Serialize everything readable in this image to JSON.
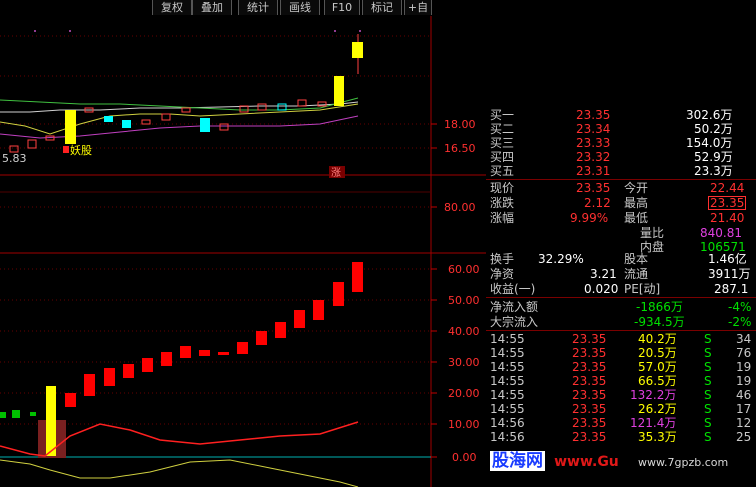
{
  "toolbar": {
    "buttons": [
      "复权",
      "叠加",
      "统计",
      "画线",
      "F10",
      "标记",
      "+自"
    ],
    "diamond": "◇"
  },
  "chart": {
    "price_axis": [
      "18.00",
      "16.50"
    ],
    "vol_axis": [
      "80.00"
    ],
    "ind_axis": [
      "60.00",
      "50.00",
      "40.00",
      "30.00",
      "20.00",
      "10.00",
      "0.00"
    ],
    "low_label": "5.83",
    "tag": "妖股",
    "zhang_badge": "涨"
  },
  "quotes": {
    "buy": [
      {
        "name": "买一",
        "price": "23.35",
        "vol": "302.6万"
      },
      {
        "name": "买二",
        "price": "23.34",
        "vol": "50.2万"
      },
      {
        "name": "买三",
        "price": "23.33",
        "vol": "154.0万"
      },
      {
        "name": "买四",
        "price": "23.32",
        "vol": "52.9万"
      },
      {
        "name": "买五",
        "price": "23.31",
        "vol": "23.3万"
      }
    ]
  },
  "stats": {
    "xianjia": {
      "label": "现价",
      "value": "23.35"
    },
    "jinkai": {
      "label": "今开",
      "value": "22.44"
    },
    "zhangdie": {
      "label": "涨跌",
      "value": "2.12"
    },
    "zuigao": {
      "label": "最高",
      "value": "23.35"
    },
    "zhangfu": {
      "label": "涨幅",
      "value": "9.99%"
    },
    "zuidi": {
      "label": "最低",
      "value": "21.40"
    },
    "liangbi": {
      "label": "量比",
      "value": "840.81"
    },
    "neipan": {
      "label": "内盘",
      "value": "106571"
    },
    "huanshou": {
      "label": "换手",
      "value": "32.29%"
    },
    "guben": {
      "label": "股本",
      "value": "1.46亿"
    },
    "jingzi": {
      "label": "净资",
      "value": "3.21"
    },
    "liutong": {
      "label": "流通",
      "value": "3911万"
    },
    "shouyi": {
      "label": "收益(一)",
      "value": "0.020"
    },
    "pe": {
      "label": "PE[动]",
      "value": "287.1"
    }
  },
  "flows": [
    {
      "label": "净流入额",
      "value": "-1866万",
      "pct": "-4%"
    },
    {
      "label": "大宗流入",
      "value": "-934.5万",
      "pct": "-2%"
    }
  ],
  "ticks": [
    {
      "time": "14:55",
      "price": "23.35",
      "vol": "40.2万",
      "dir": "S",
      "num": "34",
      "vc": "yellow"
    },
    {
      "time": "14:55",
      "price": "23.35",
      "vol": "20.5万",
      "dir": "S",
      "num": "76",
      "vc": "yellow"
    },
    {
      "time": "14:55",
      "price": "23.35",
      "vol": "57.0万",
      "dir": "S",
      "num": "19",
      "vc": "yellow"
    },
    {
      "time": "14:55",
      "price": "23.35",
      "vol": "66.5万",
      "dir": "S",
      "num": "19",
      "vc": "yellow"
    },
    {
      "time": "14:55",
      "price": "23.35",
      "vol": "132.2万",
      "dir": "S",
      "num": "46",
      "vc": "purple"
    },
    {
      "time": "14:55",
      "price": "23.35",
      "vol": "26.2万",
      "dir": "S",
      "num": "17",
      "vc": "yellow"
    },
    {
      "time": "14:56",
      "price": "23.35",
      "vol": "121.4万",
      "dir": "S",
      "num": "12",
      "vc": "purple"
    },
    {
      "time": "14:56",
      "price": "23.35",
      "vol": "35.3万",
      "dir": "S",
      "num": "25",
      "vc": "yellow"
    }
  ],
  "watermark": {
    "cn": "股海网",
    "en": "www.Gu",
    "url": "www.7gpzb.com"
  }
}
